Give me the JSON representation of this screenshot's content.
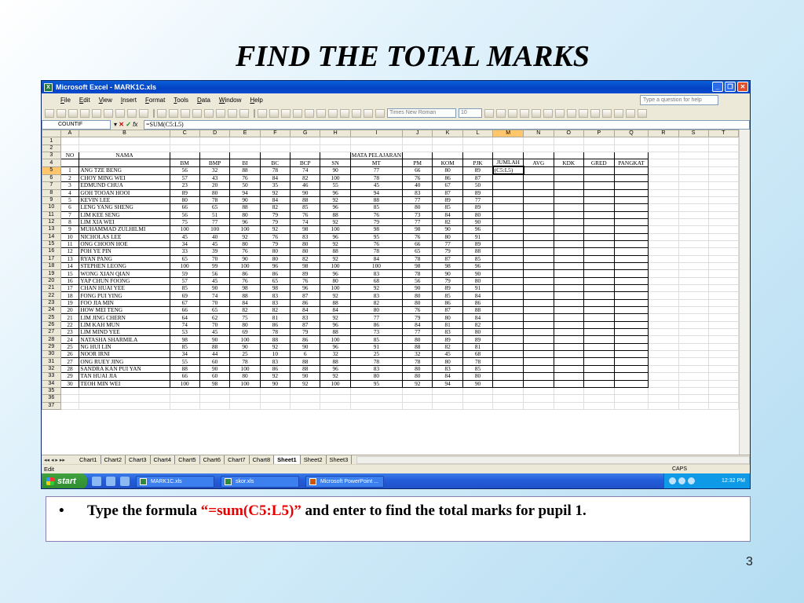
{
  "slide": {
    "title": "FIND THE TOTAL MARKS",
    "bullet_before": "Type the formula ",
    "bullet_formula": "“=sum(C5:L5)”",
    "bullet_after": " and enter to find the total marks for pupil 1.",
    "page_number": "3",
    "accent_color": "#e60000"
  },
  "window": {
    "title": "Microsoft Excel - MARK1C.xls",
    "app_icon": "excel-icon",
    "menu": [
      "File",
      "Edit",
      "View",
      "Insert",
      "Format",
      "Tools",
      "Data",
      "Window",
      "Help"
    ],
    "help_placeholder": "Type a question for help",
    "font_name": "Times New Roman",
    "font_size": "10",
    "name_box": "COUNTIF",
    "formula": "=SUM(C5:L5)"
  },
  "sheet": {
    "columns": [
      "A",
      "B",
      "C",
      "D",
      "E",
      "F",
      "G",
      "H",
      "I",
      "J",
      "K",
      "L",
      "M",
      "N",
      "O",
      "P",
      "Q",
      "R",
      "S",
      "T"
    ],
    "row3": {
      "no": "NO",
      "nama": "NAMA",
      "mata": "MATA PELAJARAN"
    },
    "headers": [
      "BM",
      "BMP",
      "BI",
      "BC",
      "BCP",
      "SN",
      "MT",
      "PM",
      "KOM",
      "PJK",
      "JUMLAH",
      "AVG",
      "KDK",
      "GRED",
      "PANGKAT"
    ],
    "active_cell": "(C5:L5)",
    "rows": [
      {
        "no": "1",
        "name": "ANG TZE BENG",
        "m": [
          "56",
          "32",
          "88",
          "78",
          "74",
          "90",
          "77",
          "66",
          "80",
          "89"
        ]
      },
      {
        "no": "2",
        "name": "CHOY MING WEI",
        "m": [
          "57",
          "43",
          "76",
          "84",
          "82",
          "100",
          "78",
          "76",
          "86",
          "87"
        ]
      },
      {
        "no": "3",
        "name": "EDMUND CHUA",
        "m": [
          "23",
          "20",
          "50",
          "35",
          "46",
          "55",
          "45",
          "40",
          "67",
          "50"
        ]
      },
      {
        "no": "4",
        "name": "GOH TOOAN HOOI",
        "m": [
          "89",
          "80",
          "94",
          "92",
          "90",
          "96",
          "94",
          "83",
          "87",
          "89"
        ]
      },
      {
        "no": "5",
        "name": "KEVIN LEE",
        "m": [
          "80",
          "78",
          "90",
          "84",
          "88",
          "92",
          "88",
          "77",
          "89",
          "77"
        ]
      },
      {
        "no": "6",
        "name": "LENG YANG SHENG",
        "m": [
          "66",
          "65",
          "88",
          "82",
          "85",
          "96",
          "85",
          "80",
          "85",
          "89"
        ]
      },
      {
        "no": "7",
        "name": "LIM KEE SENG",
        "m": [
          "56",
          "51",
          "80",
          "79",
          "76",
          "88",
          "76",
          "73",
          "84",
          "80"
        ]
      },
      {
        "no": "8",
        "name": "LIM XIA WEI",
        "m": [
          "75",
          "77",
          "96",
          "79",
          "74",
          "92",
          "79",
          "77",
          "82",
          "90"
        ]
      },
      {
        "no": "9",
        "name": "MUHAMMAD ZULHILMI",
        "m": [
          "100",
          "100",
          "100",
          "92",
          "98",
          "100",
          "98",
          "98",
          "90",
          "96"
        ]
      },
      {
        "no": "10",
        "name": "NICHOLAS LEE",
        "m": [
          "45",
          "40",
          "92",
          "76",
          "83",
          "96",
          "95",
          "76",
          "80",
          "91"
        ]
      },
      {
        "no": "11",
        "name": "ONG CHOON HOE",
        "m": [
          "34",
          "45",
          "80",
          "79",
          "80",
          "92",
          "76",
          "66",
          "77",
          "89"
        ]
      },
      {
        "no": "12",
        "name": "POH YE PIN",
        "m": [
          "33",
          "39",
          "76",
          "80",
          "80",
          "88",
          "78",
          "65",
          "79",
          "88"
        ]
      },
      {
        "no": "13",
        "name": "RYAN PANG",
        "m": [
          "65",
          "70",
          "90",
          "80",
          "82",
          "92",
          "84",
          "78",
          "87",
          "85"
        ]
      },
      {
        "no": "14",
        "name": "STEPHEN LEONG",
        "m": [
          "100",
          "99",
          "100",
          "96",
          "98",
          "100",
          "100",
          "98",
          "98",
          "96"
        ]
      },
      {
        "no": "15",
        "name": "WONG XIAN QIAN",
        "m": [
          "59",
          "56",
          "86",
          "86",
          "89",
          "96",
          "83",
          "78",
          "90",
          "90"
        ]
      },
      {
        "no": "16",
        "name": "YAP CHUN FOONG",
        "m": [
          "57",
          "45",
          "76",
          "65",
          "76",
          "80",
          "68",
          "56",
          "79",
          "80"
        ]
      },
      {
        "no": "17",
        "name": "CHAN HUAI YEE",
        "m": [
          "85",
          "90",
          "98",
          "98",
          "96",
          "100",
          "92",
          "90",
          "89",
          "91"
        ]
      },
      {
        "no": "18",
        "name": "FONG PUI YING",
        "m": [
          "69",
          "74",
          "88",
          "83",
          "87",
          "92",
          "83",
          "80",
          "85",
          "84"
        ]
      },
      {
        "no": "19",
        "name": "FOO JIA MIN",
        "m": [
          "67",
          "70",
          "84",
          "83",
          "86",
          "88",
          "82",
          "80",
          "86",
          "86"
        ]
      },
      {
        "no": "20",
        "name": "HOW MEI TENG",
        "m": [
          "66",
          "65",
          "82",
          "82",
          "84",
          "84",
          "80",
          "76",
          "87",
          "88"
        ]
      },
      {
        "no": "21",
        "name": "LIM JING CHERN",
        "m": [
          "64",
          "62",
          "75",
          "81",
          "83",
          "92",
          "77",
          "79",
          "80",
          "84"
        ]
      },
      {
        "no": "22",
        "name": "LIM KAH MUN",
        "m": [
          "74",
          "70",
          "80",
          "86",
          "87",
          "96",
          "86",
          "84",
          "81",
          "82"
        ]
      },
      {
        "no": "23",
        "name": "LIM MIND YEE",
        "m": [
          "53",
          "45",
          "69",
          "78",
          "79",
          "88",
          "73",
          "77",
          "83",
          "80"
        ]
      },
      {
        "no": "24",
        "name": "NATASHA SHARMILA",
        "m": [
          "98",
          "90",
          "100",
          "88",
          "86",
          "100",
          "85",
          "80",
          "89",
          "89"
        ]
      },
      {
        "no": "25",
        "name": "NG HUI LIN",
        "m": [
          "85",
          "88",
          "90",
          "92",
          "90",
          "96",
          "91",
          "88",
          "82",
          "81"
        ]
      },
      {
        "no": "26",
        "name": "NOOR IRNI",
        "m": [
          "34",
          "44",
          "25",
          "10",
          "6",
          "32",
          "25",
          "32",
          "45",
          "68"
        ]
      },
      {
        "no": "27",
        "name": "ONG RUEY JING",
        "m": [
          "55",
          "60",
          "78",
          "83",
          "88",
          "88",
          "78",
          "78",
          "80",
          "78"
        ]
      },
      {
        "no": "28",
        "name": "SANDRA KAN PUI YAN",
        "m": [
          "88",
          "90",
          "100",
          "86",
          "88",
          "96",
          "83",
          "80",
          "83",
          "85"
        ]
      },
      {
        "no": "29",
        "name": "TAN HUAI JIA",
        "m": [
          "66",
          "60",
          "80",
          "92",
          "90",
          "92",
          "80",
          "80",
          "84",
          "80"
        ]
      },
      {
        "no": "30",
        "name": "TEOH MIN WEI",
        "m": [
          "100",
          "98",
          "100",
          "90",
          "92",
          "100",
          "95",
          "92",
          "94",
          "90"
        ]
      }
    ]
  },
  "sheet_tabs": [
    "Chart1",
    "Chart2",
    "Chart3",
    "Chart4",
    "Chart5",
    "Chart6",
    "Chart7",
    "Chart8",
    "Sheet1",
    "Sheet2",
    "Sheet3"
  ],
  "active_tab": "Sheet1",
  "status": {
    "mode": "Edit",
    "caps": "CAPS"
  },
  "taskbar": {
    "start": "start",
    "tasks": [
      "MARK1C.xls",
      "skor.xls",
      "Microsoft PowerPoint ..."
    ],
    "clock": "12:32 PM"
  }
}
